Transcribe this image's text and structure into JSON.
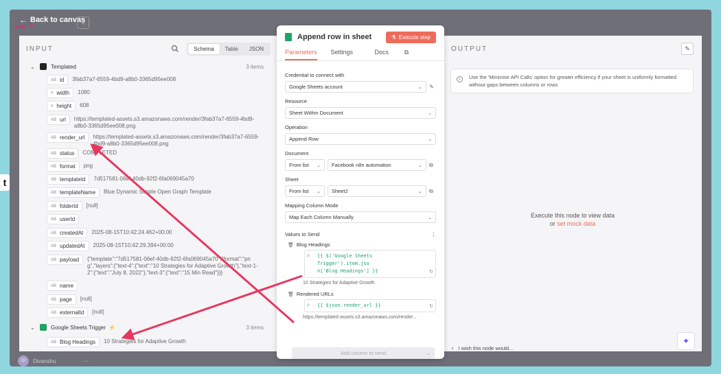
{
  "topbar": {
    "back_label": "Back to canvas",
    "plus": "+"
  },
  "side_tab": "t",
  "input_panel": {
    "title": "INPUT",
    "view_tabs": [
      "Schema",
      "Table",
      "JSON"
    ],
    "groups": [
      {
        "name": "Templated",
        "count": "3 items"
      },
      {
        "name": "Google Sheets Trigger",
        "count": "3 items",
        "bolt": "⚡"
      }
    ],
    "fields": [
      {
        "type": "AB",
        "key": "id",
        "value": "3fab37a7-6559-4bd9-a8b0-3365d95ee008"
      },
      {
        "type": "#",
        "key": "width",
        "value": "1080"
      },
      {
        "type": "#",
        "key": "height",
        "value": "608"
      },
      {
        "type": "AB",
        "key": "url",
        "value": "https://templated-assets.s3.amazonaws.com/render/3fab37a7-6559-4bd9-a8b0-3365d95ee008.png"
      },
      {
        "type": "AB",
        "key": "render_url",
        "value": "https://templated-assets.s3.amazonaws.com/render/3fab37a7-6559-4bd9-a8b0-3365d95ee008.png"
      },
      {
        "type": "AB",
        "key": "status",
        "value": "COMPLETED"
      },
      {
        "type": "AB",
        "key": "format",
        "value": "png"
      },
      {
        "type": "AB",
        "key": "templateId",
        "value": "7d517581-06ef-40db-92f2-6fa069045a70"
      },
      {
        "type": "AB",
        "key": "templateName",
        "value": "Blue Dynamic Simple Open Graph Template"
      },
      {
        "type": "AB",
        "key": "folderId",
        "value": "[null]"
      },
      {
        "type": "AB",
        "key": "userId",
        "value": ""
      },
      {
        "type": "AB",
        "key": "createdAt",
        "value": "2025-08-15T10:42:24.462+00:00"
      },
      {
        "type": "AB",
        "key": "updatedAt",
        "value": "2025-08-15T10:42:29.394+00:00"
      },
      {
        "type": "AB",
        "key": "payload",
        "value": "{\"template\":\"7d517581-06ef-40db-92f2-6fa069045a70\",\"format\":\"png\",\"layers\":{\"text-4\":{\"text\":\"10 Strategies for Adaptive Growth\"},\"text-1-2\":{\"text\":\"July 8, 2022\"},\"text-3\":{\"text\":\"15 Min Read\"}}}"
      },
      {
        "type": "AB",
        "key": "name",
        "value": ""
      },
      {
        "type": "AB",
        "key": "page",
        "value": "[null]"
      },
      {
        "type": "AB",
        "key": "externalId",
        "value": "[null]"
      }
    ],
    "trigger_field": {
      "type": "AB",
      "key": "Blog Headings",
      "value": "10 Strategies for Adaptive Growth"
    }
  },
  "modal": {
    "title": "Append row in sheet",
    "execute_label": "Execute step",
    "tabs": [
      "Parameters",
      "Settings"
    ],
    "docs_label": "Docs",
    "credential_label": "Credential to connect with",
    "credential_value": "Google Sheets account",
    "resource_label": "Resource",
    "resource_value": "Sheet Within Document",
    "operation_label": "Operation",
    "operation_value": "Append Row",
    "document_label": "Document",
    "document_mode": "From list",
    "document_value": "Facebook n8n automation",
    "sheet_label": "Sheet",
    "sheet_mode": "From list",
    "sheet_value": "Sheet2",
    "mapping_label": "Mapping Column Mode",
    "mapping_value": "Map Each Column Manually",
    "values_label": "Values to Send",
    "values": [
      {
        "column": "Blog Headings",
        "expr_line1": "{{ $('Google Sheets Trigger').item.jso",
        "expr_line2": "n['Blog Headings'] }}",
        "preview": "10 Strategies for Adaptive Growth"
      },
      {
        "column": "Rendered URLs",
        "expr_line1": "{{ $json.render_url }}",
        "expr_line2": "",
        "preview": "https://templated-assets.s3.amazonaws.com/render..."
      }
    ],
    "add_column_label": "Add column to send"
  },
  "output_panel": {
    "title": "OUTPUT",
    "info": "Use the 'Minimise API Calls' option for greater efficiency if your sheet is uniformly formatted without gaps between columns or rows",
    "empty_line1": "Execute this node to view data",
    "empty_or": "or",
    "empty_link": "set mock data",
    "wish_label": "I wish this node would..."
  },
  "footer": {
    "user_initials": "DI",
    "user_name": "Divanshu"
  },
  "colors": {
    "accent": "#ee6b5b",
    "sheet_green": "#1fa463",
    "expr_green": "#1aa06d",
    "arrow": "#e8365f"
  }
}
